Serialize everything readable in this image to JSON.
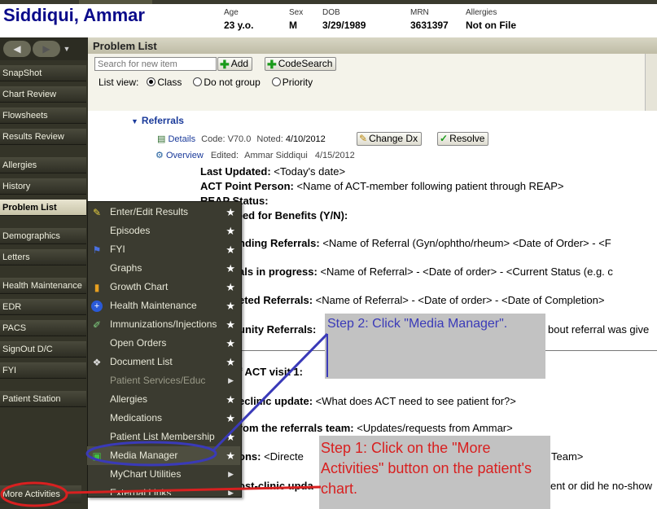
{
  "patient": {
    "name": "Siddiqui, Ammar",
    "age_label": "Age",
    "age": "23 y.o.",
    "sex_label": "Sex",
    "sex": "M",
    "dob_label": "DOB",
    "dob": "3/29/1989",
    "mrn_label": "MRN",
    "mrn": "3631397",
    "allergies_label": "Allergies",
    "allergies": "Not on File"
  },
  "nav": {
    "back": "◀",
    "forward": "▶",
    "dropdown": "▼",
    "items": [
      "SnapShot",
      "Chart Review",
      "Flowsheets",
      "Results Review",
      "Allergies",
      "History",
      "Problem List",
      "Demographics",
      "Letters",
      "Health Maintenance",
      "EDR",
      "PACS",
      "SignOut D/C",
      "FYI",
      "Patient Station"
    ],
    "more": "More Activities"
  },
  "problem_list": {
    "title": "Problem List",
    "search_placeholder": "Search for new item",
    "add_label": "Add",
    "codesearch_label": "CodeSearch",
    "listview_label": "List view:",
    "options": [
      "Class",
      "Do not group",
      "Priority"
    ],
    "selected_option": "Class"
  },
  "referral": {
    "heading": "Referrals",
    "details_link": "Details",
    "code": "Code: V70.0",
    "noted": "Noted:",
    "noted_date": "4/10/2012",
    "change_dx": "Change Dx",
    "resolve": "Resolve",
    "overview_link": "Overview",
    "edited": "Edited:",
    "edited_by": "Ammar Siddiqui",
    "edited_date": "4/15/2012"
  },
  "note": {
    "last_updated_label": "Last Updated:",
    "last_updated_value": "<Today's date>",
    "point_person_label": "ACT Point Person:",
    "point_person_value": "<Name of ACT-member following patient through REAP>",
    "reap_status": "REAP Status:",
    "benefits": "ped for Benefits (Y/N):",
    "pending_label": "nding Referrals:",
    "pending_value": "<Name of Referral (Gyn/ophtho/rheum> <Date of Order> - <F",
    "in_progress_label": "als in progress:",
    "in_progress_value": "<Name of Referral> - <Date of order> - <Current Status (e.g. c",
    "completed_label": "eted Referrals:",
    "completed_value": "<Name of Referral> - <Date of order> - <Date of Completion>",
    "community_label": "unity Referrals:",
    "community_value": "bout referral was give",
    "act_visit": "f ACT visit 1:",
    "preclinic_label": "eclinic update:",
    "preclinic_value": "<What does ACT need to see patient for?>",
    "from_team_label": "rom the referrals team:",
    "from_team_value": "<Updates/requests from Ammar>",
    "directions_label": "ons:",
    "directions_value": "<Directe",
    "team_tail": "Team>",
    "postclinic_label": "ost-clinic upda",
    "postclinic_tail": "ent or did he no-show"
  },
  "menu": {
    "items": [
      {
        "label": "Enter/Edit Results",
        "icon": "pencil-icon",
        "star": true
      },
      {
        "label": "Episodes",
        "icon": "",
        "star": true
      },
      {
        "label": "FYI",
        "icon": "flag-icon",
        "star": true
      },
      {
        "label": "Graphs",
        "icon": "",
        "star": true
      },
      {
        "label": "Growth Chart",
        "icon": "growth-chart-icon",
        "star": true
      },
      {
        "label": "Health Maintenance",
        "icon": "health-cross-icon",
        "star": true
      },
      {
        "label": "Immunizations/Injections",
        "icon": "syringe-icon",
        "star": true
      },
      {
        "label": "Open Orders",
        "icon": "",
        "star": true
      },
      {
        "label": "Document List",
        "icon": "document-list-icon",
        "star": true
      },
      {
        "label": "Patient Services/Educ",
        "icon": "",
        "submenu": true,
        "disabled": true
      },
      {
        "label": "Allergies",
        "icon": "",
        "star": true
      },
      {
        "label": "Medications",
        "icon": "",
        "star": true
      },
      {
        "label": "Patient List Membership",
        "icon": "",
        "star": true
      },
      {
        "label": "Media Manager",
        "icon": "media-manager-icon",
        "star": true
      },
      {
        "label": "MyChart Utilities",
        "icon": "",
        "submenu": true
      },
      {
        "label": "External Links",
        "icon": "",
        "submenu": true
      }
    ]
  },
  "annotations": {
    "step1": "Step 1: Click on the \"More Activities\" button on the patient's chart.",
    "step2": "Step 2: Click \"Media Manager\".",
    "step1_color": "#d82020",
    "step2_color": "#3a3ab8"
  }
}
